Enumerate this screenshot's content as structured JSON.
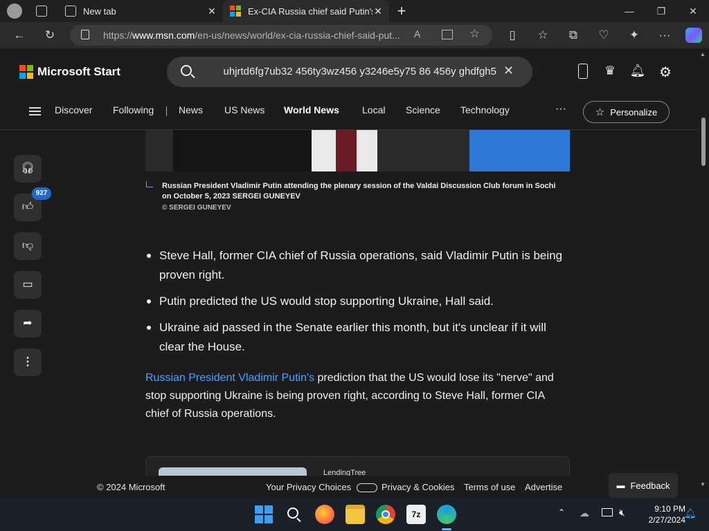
{
  "browser": {
    "tabs": [
      {
        "title": "New tab"
      },
      {
        "title": "Ex-CIA Russia chief said Putin's b"
      }
    ],
    "url_prefix": "https://",
    "url_host": "www.msn.com",
    "url_path": "/en-us/news/world/ex-cia-russia-chief-said-put..."
  },
  "header": {
    "brand": "Microsoft Start",
    "search_query": "uhjrtd6fg7ub32 456ty3wz456 y3246e5y75 86 456y ghdfgh5",
    "nav_items": [
      "Discover",
      "Following",
      "News",
      "US News",
      "World News",
      "Local",
      "Science",
      "Technology"
    ],
    "more": "···",
    "personalize": "Personalize"
  },
  "rail": {
    "like_count": "927"
  },
  "article": {
    "caption": "Russian President Vladimir Putin attending the plenary session of the Valdai Discussion Club forum in Sochi on October 5, 2023 SERGEI GUNEYEV",
    "credit": "© SERGEI GUNEYEV",
    "bullets": [
      "Steve Hall, former CIA chief of Russia operations, said Vladimir Putin is being proven right.",
      "Putin predicted the US would stop supporting Ukraine, Hall said.",
      "Ukraine aid passed in the Senate earlier this month, but it's unclear if it will clear the House."
    ],
    "para_link": "Russian President Vladimir Putin's",
    "para_text": " prediction that the US would lose its \"nerve\" and stop supporting Ukraine is being proven right, according to Steve Hall, former CIA chief of Russia operations.",
    "ad_source": "LendingTree"
  },
  "footer": {
    "copyright": "© 2024 Microsoft",
    "privacy_choices": "Your Privacy Choices",
    "privacy_cookies": "Privacy & Cookies",
    "terms": "Terms of use",
    "advertise": "Advertise",
    "feedback": "Feedback"
  },
  "taskbar": {
    "time": "9:10 PM",
    "date": "2/27/2024"
  },
  "colors": {
    "accent": "#4ea1ff",
    "badge": "#1d6ac8"
  }
}
